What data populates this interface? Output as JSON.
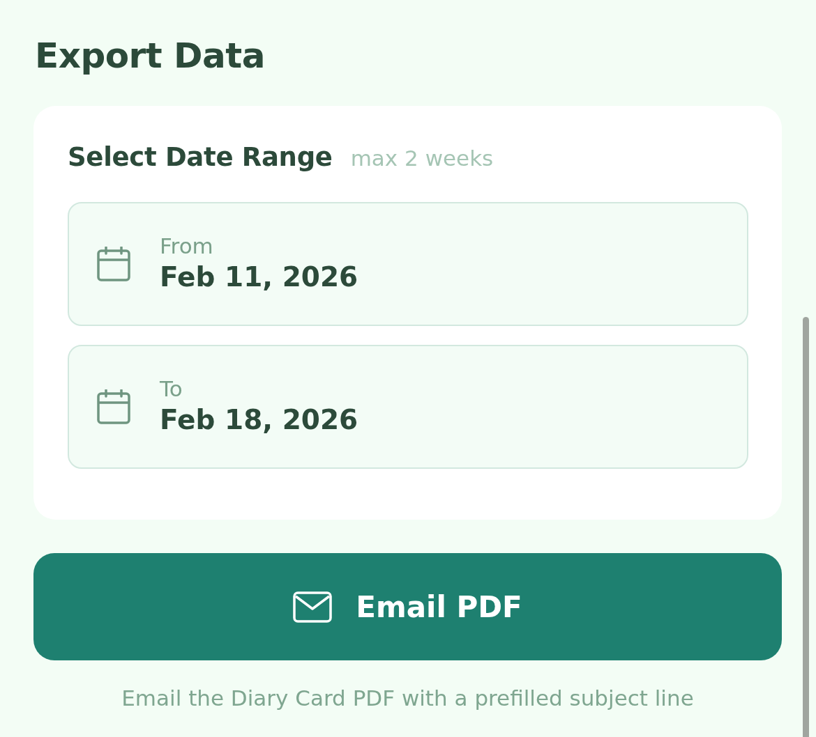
{
  "title": "Export Data",
  "date_range": {
    "heading": "Select Date Range",
    "hint": "max 2 weeks",
    "fields": [
      {
        "label": "From",
        "value": "Feb 11, 2026"
      },
      {
        "label": "To",
        "value": "Feb 18, 2026"
      }
    ]
  },
  "email_button": {
    "label": "Email PDF"
  },
  "caption": "Email the Diary Card PDF with a prefilled subject line"
}
